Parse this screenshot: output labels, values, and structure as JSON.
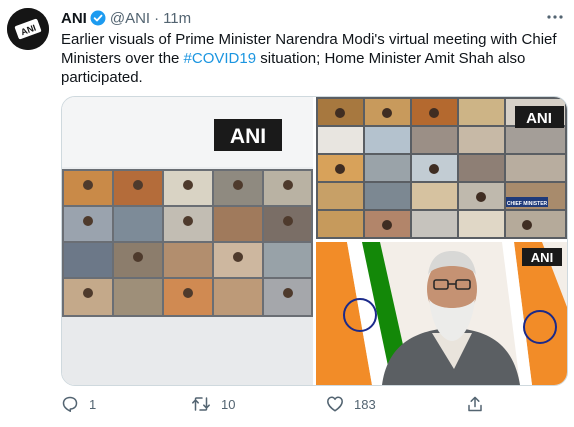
{
  "tweet": {
    "author_name": "ANI",
    "handle": "@ANI",
    "separator": "·",
    "time": "11m",
    "text_part1": "Earlier visuals of Prime Minister Narendra Modi's virtual meeting with Chief Ministers over the ",
    "hashtag": "#COVID19",
    "text_part2": " situation; Home Minister Amit Shah also participated."
  },
  "avatar": {
    "logo_text": "ANI"
  },
  "media": {
    "watermark_1": "ANI",
    "watermark_2": "ANI",
    "watermark_3": "ANI",
    "screen_label_1": "CHIEF MINISTER",
    "screen_label_2": "CHIEF MINISTER"
  },
  "actions": {
    "reply_count": "1",
    "retweet_count": "10",
    "like_count": "183"
  },
  "colors": {
    "accent": "#1b95e0",
    "verified": "#1d9bf0",
    "muted": "#536471",
    "saffron": "#f08a24",
    "flag_green": "#138808"
  }
}
